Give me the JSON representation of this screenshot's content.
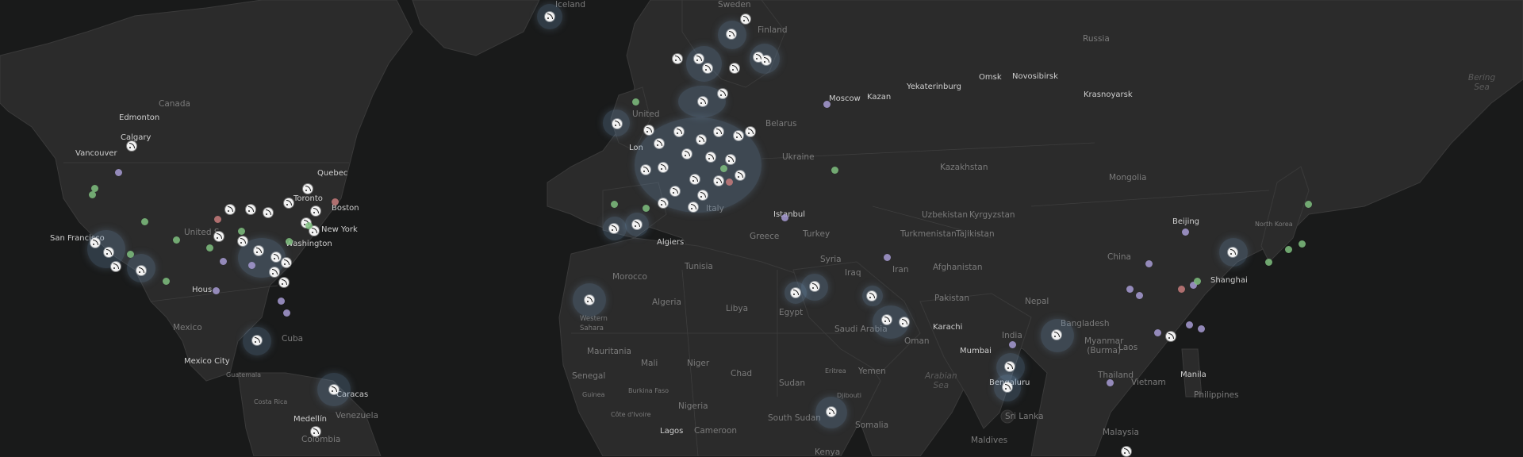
{
  "map": {
    "colors": {
      "ocean": "#191a1a",
      "land": "#2a2a2a",
      "border": "#3a3a3a",
      "cluster": "#7ea6c8",
      "dot_green": "#7fbf7f",
      "dot_violet": "#a79bd4",
      "dot_red": "#c77b7b"
    },
    "labels": {
      "iceland": "Iceland",
      "sweden": "Sweden",
      "finland": "Finland",
      "russia": "Russia",
      "bering_sea": "Bering\nSea",
      "canada": "Canada",
      "edmonton": "Edmonton",
      "calgary": "Calgary",
      "vancouver": "Vancouver",
      "quebec": "Quebec",
      "toronto": "Toronto",
      "boston": "Boston",
      "new_york": "New York",
      "washington": "Washington",
      "united_states": "United S",
      "san_francisco": "San Francisco",
      "houston": "Hous",
      "mexico": "Mexico",
      "mexico_city": "Mexico City",
      "cuba": "Cuba",
      "guatemala": "Guatemala",
      "costa_rica": "Costa Rica",
      "caracas": "Caracas",
      "venezuela": "Venezuela",
      "medellin": "Medellín",
      "colombia": "Colombia",
      "moscow": "Moscow",
      "kazan": "Kazan",
      "yekaterinburg": "Yekaterinburg",
      "omsk": "Omsk",
      "novosibirsk": "Novosibirsk",
      "krasnoyarsk": "Krasnoyarsk",
      "belarus": "Belarus",
      "ukraine": "Ukraine",
      "kazakhstan": "Kazakhstan",
      "mongolia": "Mongolia",
      "uzbekistan": "Uzbekistan",
      "kyrgyzstan": "Kyrgyzstan",
      "turkmenistan": "Turkmenistan",
      "tajikistan": "Tajikistan",
      "istanbul": "Istanbul",
      "turkey": "Turkey",
      "greece": "Greece",
      "italy": "Italy",
      "algiers": "Algiers",
      "tunisia": "Tunisia",
      "morocco": "Morocco",
      "algeria": "Algeria",
      "libya": "Libya",
      "egypt": "Egypt",
      "syria": "Syria",
      "iraq": "Iraq",
      "iran": "Iran",
      "afghanistan": "Afghanistan",
      "pakistan": "Pakistan",
      "karachi": "Karachi",
      "mumbai": "Mumbai",
      "india": "India",
      "nepal": "Nepal",
      "bangladesh": "Bangladesh",
      "myanmar": "Myanmar\n(Burma)",
      "laos": "Laos",
      "thailand": "Thailand",
      "vietnam": "Vietnam",
      "malaysia": "Malaysia",
      "manila": "Manila",
      "philippines": "Philippines",
      "china": "China",
      "beijing": "Beijing",
      "shanghai": "Shanghai",
      "north_korea": "North Korea",
      "saudi_arabia": "Saudi Arabia",
      "oman": "Oman",
      "yemen": "Yemen",
      "arabian_sea": "Arabian\nSea",
      "sri_lanka": "Sri Lanka",
      "bengaluru": "Bengaluru",
      "maldives": "Maldives",
      "western_sahara": "Western\nSahara",
      "mauritania": "Mauritania",
      "mali": "Mali",
      "niger": "Niger",
      "chad": "Chad",
      "sudan": "Sudan",
      "senegal": "Senegal",
      "burkina_faso": "Burkina Faso",
      "guinea": "Guinea",
      "cote_divoire": "Côte d'Ivoire",
      "nigeria": "Nigeria",
      "lagos": "Lagos",
      "cameroon": "Cameroon",
      "south_sudan": "South Sudan",
      "eritrea": "Eritrea",
      "djibouti": "Djibouti",
      "somalia": "Somalia",
      "kenya": "Kenya",
      "london": "Lon",
      "united_kingdom": "United"
    }
  }
}
